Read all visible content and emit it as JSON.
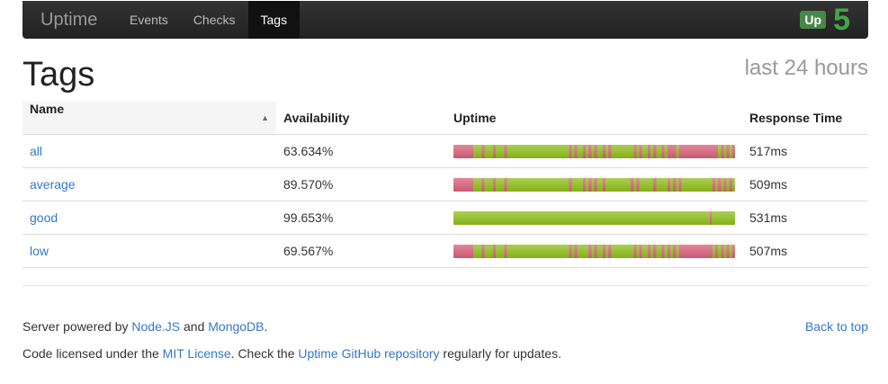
{
  "nav": {
    "brand": "Uptime",
    "items": [
      {
        "label": "Events",
        "active": false
      },
      {
        "label": "Checks",
        "active": false
      },
      {
        "label": "Tags",
        "active": true
      }
    ],
    "status_badge": "Up",
    "up_count": "5"
  },
  "page": {
    "title": "Tags",
    "period": "last 24 hours"
  },
  "table": {
    "headers": {
      "name": "Name",
      "availability": "Availability",
      "uptime": "Uptime",
      "response_time": "Response Time"
    },
    "rows": [
      {
        "name": "all",
        "availability": "63.634%",
        "response_time": "517ms"
      },
      {
        "name": "average",
        "availability": "89.570%",
        "response_time": "509ms"
      },
      {
        "name": "good",
        "availability": "99.653%",
        "response_time": "531ms"
      },
      {
        "name": "low",
        "availability": "69.567%",
        "response_time": "507ms"
      }
    ]
  },
  "footer": {
    "line1_prefix": "Server powered by ",
    "node_link": "Node.JS",
    "and": " and ",
    "mongo_link": "MongoDB",
    "line1_suffix": ".",
    "line2_prefix": "Code licensed under the ",
    "mit_link": "MIT License",
    "line2_mid": ". Check the ",
    "repo_link": "Uptime GitHub repository",
    "line2_suffix": " regularly for updates.",
    "back_to_top": "Back to top"
  },
  "colors": {
    "up": "#8fbf1a",
    "down": "#d9607a",
    "accent": "#3478c6"
  }
}
